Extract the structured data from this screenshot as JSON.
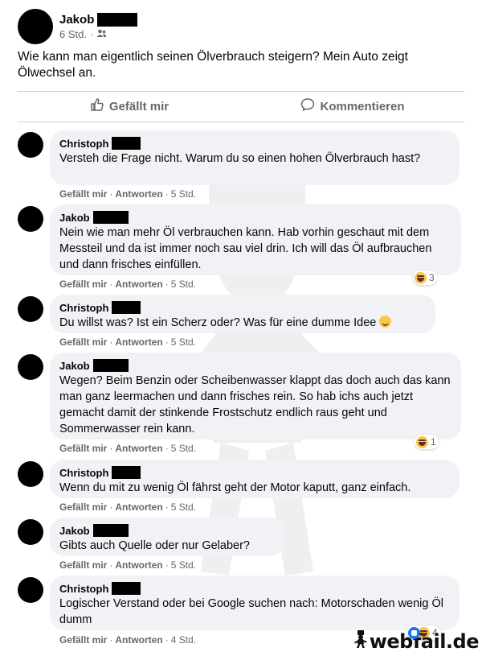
{
  "post": {
    "author": "Jakob",
    "time": "6 Std.",
    "audience_icon": "friends-icon",
    "text": "Wie kann man eigentlich seinen Ölverbrauch steigern? Mein Auto zeigt Ölwechsel an."
  },
  "actions": {
    "like_label": "Gefällt mir",
    "comment_label": "Kommentieren"
  },
  "comment_actions": {
    "like": "Gefällt mir",
    "reply": "Antworten"
  },
  "comments": [
    {
      "author": "Christoph",
      "text": "Versteh die Frage nicht. Warum du so einen hohen Ölverbrauch hast?",
      "time": "5 Std."
    },
    {
      "author": "Jakob",
      "text": "Nein wie man mehr Öl verbrauchen kann. Hab vorhin geschaut mit dem Messteil und da ist immer noch sau viel drin. Ich will das Öl aufbrauchen und dann frisches einfüllen.",
      "time": "5 Std.",
      "reactions": {
        "icons": [
          "haha-emoji"
        ],
        "count": "3"
      }
    },
    {
      "author": "Christoph",
      "text": "Du willst was? Ist ein Scherz oder? Was für eine dumme Idee",
      "time": "5 Std.",
      "inline_emoji": "smile-emoji"
    },
    {
      "author": "Jakob",
      "text": "Wegen? Beim Benzin oder Scheibenwasser klappt das doch auch das kann man ganz leermachen und dann frisches rein. So hab ichs auch jetzt gemacht damit der stinkende Frostschutz endlich raus geht und Sommerwasser rein kann.",
      "time": "5 Std.",
      "reactions": {
        "icons": [
          "haha-emoji"
        ],
        "count": "1"
      }
    },
    {
      "author": "Christoph",
      "text": "Wenn du mit zu wenig Öl fährst geht der Motor kaputt, ganz einfach.",
      "time": "5 Std."
    },
    {
      "author": "Jakob",
      "text": "Gibts auch Quelle oder nur Gelaber?",
      "time": "5 Std."
    },
    {
      "author": "Christoph",
      "text": "Logischer Verstand oder bei Google suchen nach: Motorschaden wenig Öl dumm",
      "time": "4 Std.",
      "reactions": {
        "icons": [
          "like-emoji",
          "haha-emoji"
        ],
        "count": "4"
      }
    }
  ],
  "watermark": {
    "text": "webfail.de"
  }
}
